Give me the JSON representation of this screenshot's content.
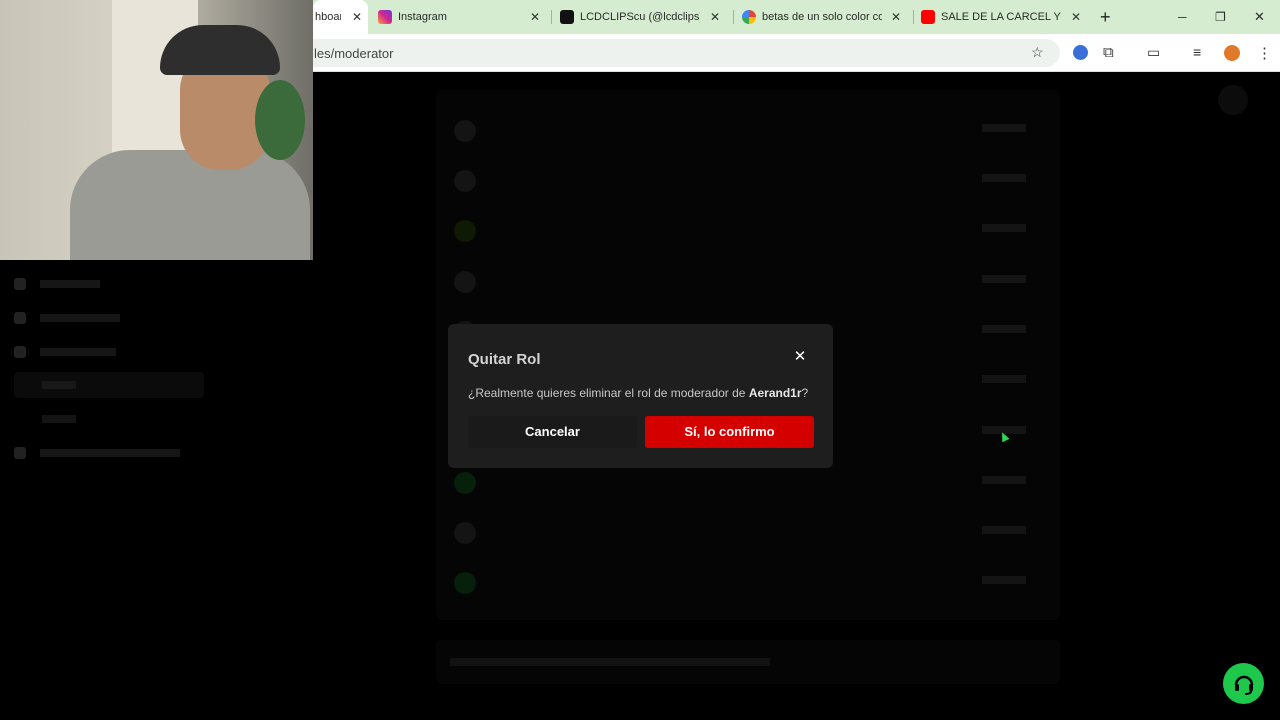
{
  "browser": {
    "tabs": [
      {
        "title": "hboar",
        "active": true
      },
      {
        "title": "Instagram"
      },
      {
        "title": "LCDCLIPScu (@lcdclips) | Ti"
      },
      {
        "title": "betas de un solo color com"
      },
      {
        "title": "SALE DE LA CARCEL Y GAN"
      }
    ],
    "new_tab_symbol": "+",
    "url": "les/moderator",
    "window_controls": [
      "─",
      "❐",
      "✕"
    ]
  },
  "modal": {
    "title": "Quitar Rol",
    "message_prefix": "¿Realmente quieres eliminar el rol de moderador de ",
    "username": "Aerand1r",
    "message_suffix": "?",
    "cancel_label": "Cancelar",
    "confirm_label": "Sí, lo confirmo",
    "confirm_color": "#d40000"
  },
  "colors": {
    "help_button": "#1ec84a",
    "tab_strip": "#d5ecd0"
  },
  "icons": {
    "help": "headset-icon",
    "close": "close-icon",
    "bookmark": "star-icon",
    "extensions": "puzzle-icon",
    "menu": "kebab-menu-icon"
  }
}
